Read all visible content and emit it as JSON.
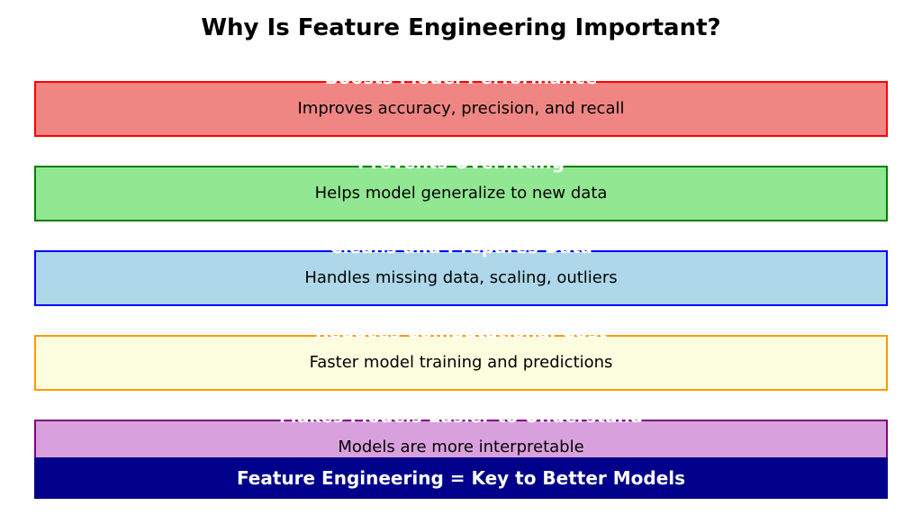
{
  "title": "Why Is Feature Engineering Important?",
  "items": [
    {
      "heading": "Boosts Model Performance",
      "desc": "Improves accuracy, precision, and recall",
      "fill": "#ef8683",
      "border": "#ff0000"
    },
    {
      "heading": "Prevents Overfitting",
      "desc": "Helps model generalize to new data",
      "fill": "#92e792",
      "border": "#008000"
    },
    {
      "heading": "Cleans and Prepares Data",
      "desc": "Handles missing data, scaling, outliers",
      "fill": "#aed8ea",
      "border": "#0000ff"
    },
    {
      "heading": "Reduces Computational Cost",
      "desc": "Faster model training and predictions",
      "fill": "#fdfde0",
      "border": "#ff9900"
    },
    {
      "heading": "Makes Models Easier to Understand",
      "desc": "Models are more interpretable",
      "fill": "#d9a0de",
      "border": "#800080"
    }
  ],
  "footer": "Feature Engineering = Key to Better Models"
}
